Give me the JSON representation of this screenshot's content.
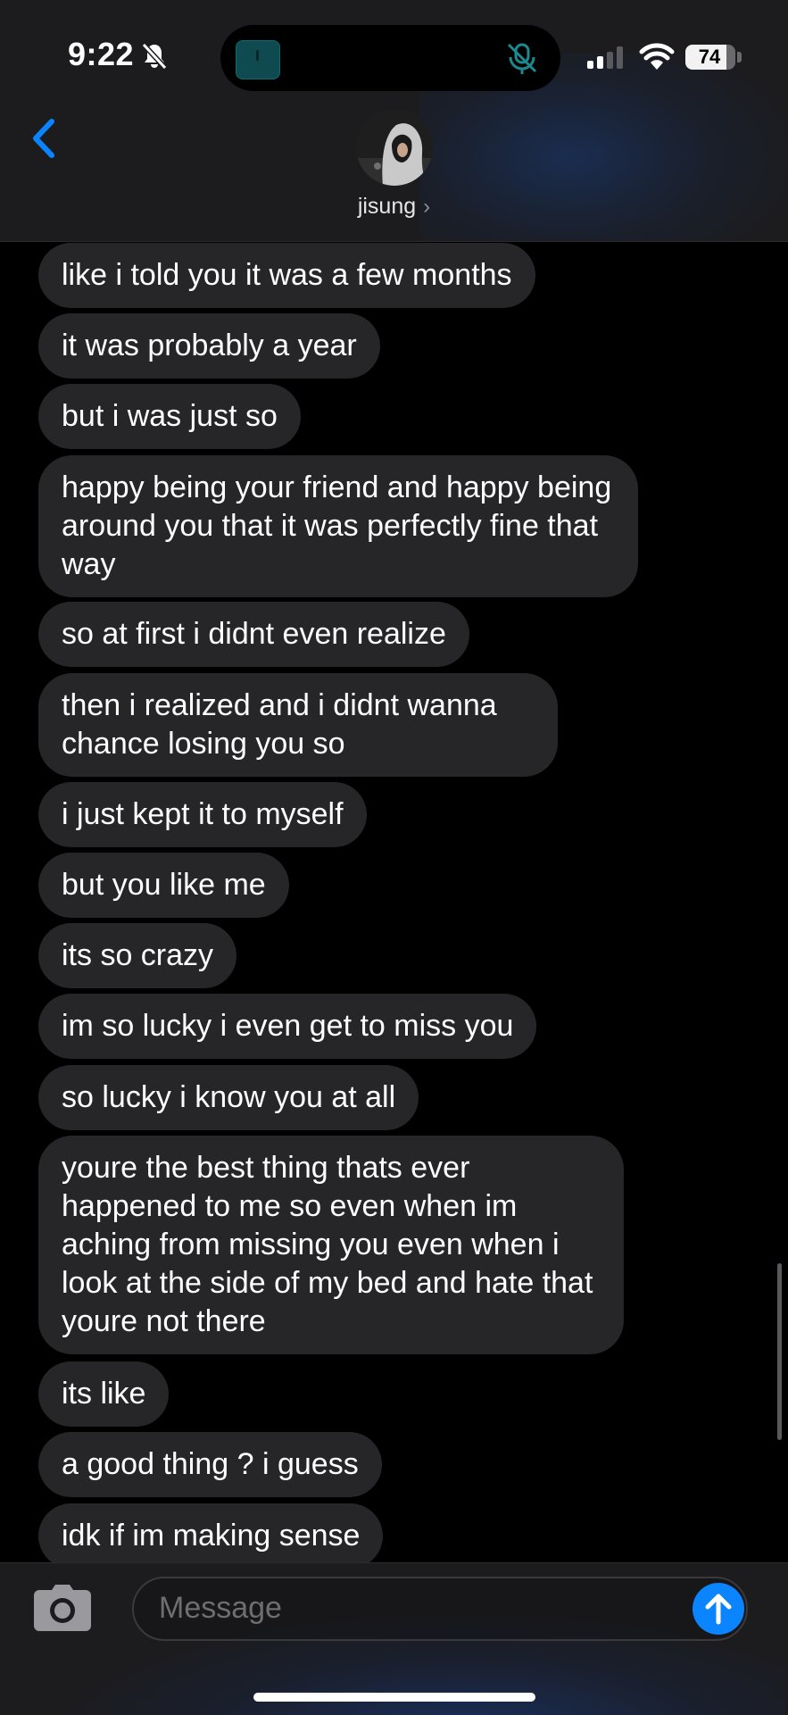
{
  "status_bar": {
    "time": "9:22",
    "battery": "74"
  },
  "header": {
    "contact_name": "jisung",
    "chevron": "›"
  },
  "messages": [
    "like i told you it was a few months",
    "it was probably a year",
    "but i was just so",
    "happy being your friend and happy being around you that it was perfectly fine that way",
    "so at first i didnt even realize",
    "then i realized and i didnt wanna chance losing you so",
    "i just kept it to myself",
    "but you like me",
    "its so crazy",
    "im so lucky i even get to miss you",
    "so lucky i know you at all",
    "youre the best thing thats ever happened to me so even when im aching from missing you even when i look at the side of my bed and hate that youre not there",
    "its like",
    "a good thing ? i guess",
    "idk if im making sense"
  ],
  "input": {
    "placeholder": "Message"
  },
  "colors": {
    "bubble_incoming": "#262628",
    "accent": "#0a84ff",
    "background": "#000000",
    "bar": "#1c1c1e"
  },
  "icons": {
    "back": "chevron-left-icon",
    "mute": "bell-slash-icon",
    "camera": "camera-icon",
    "send": "arrow-up-icon",
    "signal": "cellular-signal-icon",
    "wifi": "wifi-icon",
    "battery": "battery-icon"
  }
}
